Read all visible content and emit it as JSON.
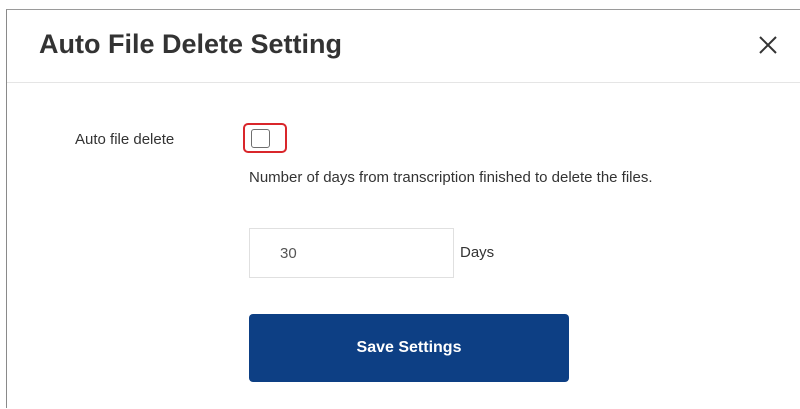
{
  "dialog": {
    "title": "Auto File Delete Setting",
    "close_icon": "close-icon"
  },
  "form": {
    "auto_delete_label": "Auto file delete",
    "auto_delete_checked": false,
    "description": "Number of days from transcription finished to delete the files.",
    "days_value": "30",
    "days_unit": "Days",
    "save_label": "Save Settings"
  },
  "colors": {
    "primary_button": "#0d3f84",
    "focus_outline": "#d9262b",
    "title_text": "#333333"
  }
}
